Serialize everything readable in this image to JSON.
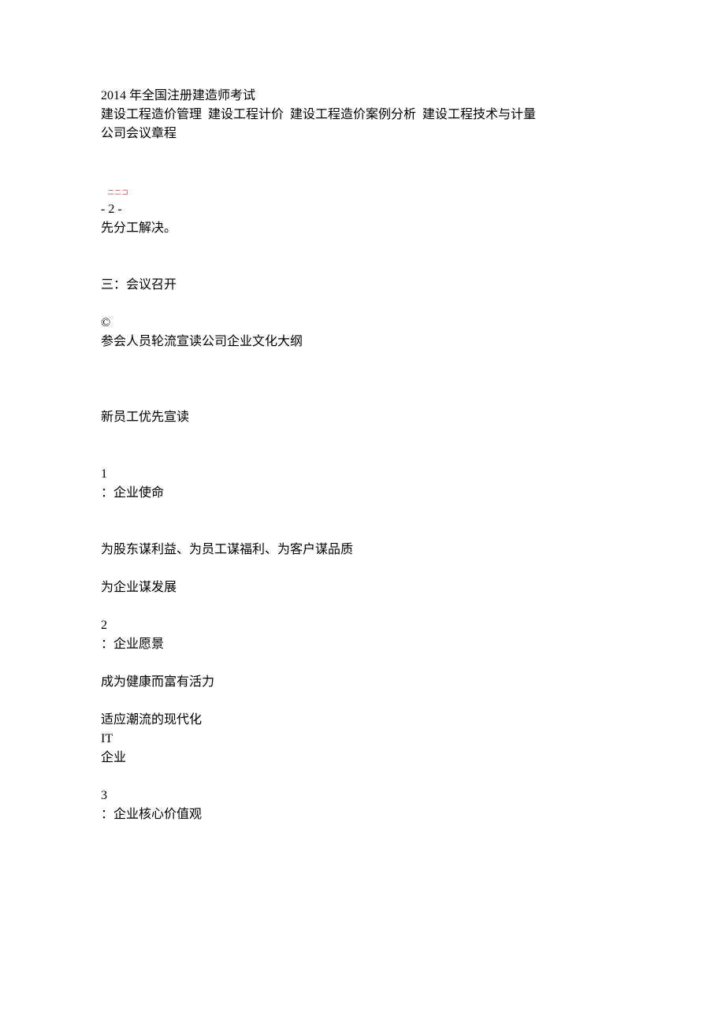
{
  "header": {
    "line1_a": "2014",
    "line1_b": " 年全国注册建造师考试",
    "line2": "建设工程造价管理  建设工程计价  建设工程造价案例分析  建设工程技术与计量",
    "line3": "公司会议章程"
  },
  "mark": "ニニコ",
  "page_marker": "- 2 -",
  "pre_text": "先分工解决。",
  "section3_title": "三：会议召开",
  "copyright": "©",
  "reading_line": "参会人员轮流宣读公司企业文化大纲",
  "priority_line": "新员工优先宣读",
  "items": {
    "i1_num": "1",
    "i1_label": "：企业使命",
    "i1_body_a": "为股东谋利益、为员工谋福利、为客户谋品质",
    "i1_body_b": "为企业谋发展",
    "i2_num": "2",
    "i2_label": "：企业愿景",
    "i2_body_a": "成为健康而富有活力",
    "i2_body_b": "适应潮流的现代化",
    "i2_body_c": "IT",
    "i2_body_d": "企业",
    "i3_num": "3",
    "i3_label": "：企业核心价值观"
  }
}
